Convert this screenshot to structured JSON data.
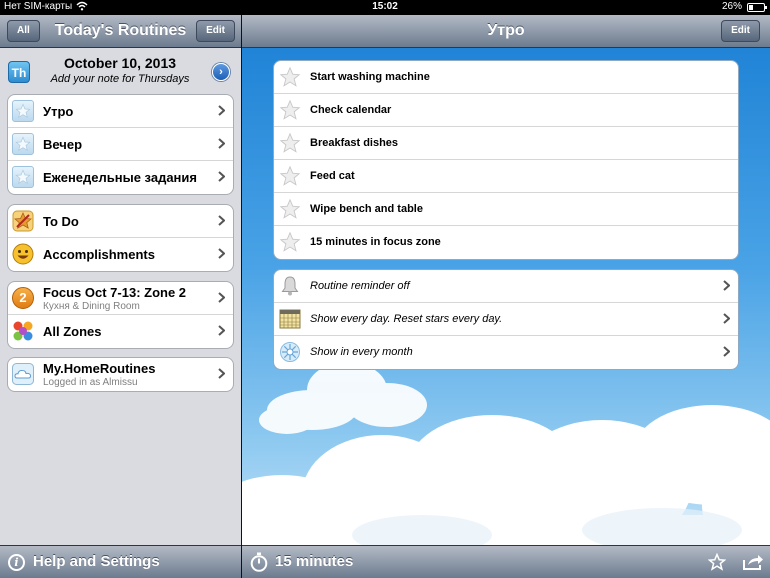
{
  "status": {
    "carrier": "Нет SIM-карты",
    "time": "15:02",
    "battery": "26%"
  },
  "left": {
    "title": "Today's Routines",
    "all_label": "All",
    "edit_label": "Edit",
    "date": "October 10, 2013",
    "note": "Add your note for Thursdays",
    "th_label": "Th",
    "routines": [
      {
        "label": "Утро",
        "icon": "star-icon"
      },
      {
        "label": "Вечер",
        "icon": "star-icon"
      },
      {
        "label": "Еженедельные задания",
        "icon": "star-icon"
      }
    ],
    "lists": [
      {
        "label": "To Do",
        "icon": "todo-star-icon"
      },
      {
        "label": "Accomplishments",
        "icon": "smiley-icon"
      }
    ],
    "zones": [
      {
        "label": "Focus Oct 7-13: Zone 2",
        "sub": "Кухня & Dining Room",
        "icon": "zone-number-icon",
        "icon_text": "2"
      },
      {
        "label": "All Zones",
        "icon": "zones-grid-icon"
      }
    ],
    "account": {
      "label": "My.HomeRoutines",
      "sub": "Logged in as Almissu",
      "icon": "cloud-icon"
    },
    "help_label": "Help and Settings"
  },
  "right": {
    "title": "Утро",
    "edit_label": "Edit",
    "tasks": [
      "Start washing machine",
      "Check calendar",
      "Breakfast dishes",
      "Feed cat",
      "Wipe bench and table",
      "15 minutes in focus zone"
    ],
    "options": [
      {
        "label": "Routine reminder off",
        "icon": "bell-icon"
      },
      {
        "label": "Show every day. Reset stars every day.",
        "icon": "calendar-icon"
      },
      {
        "label": "Show in every month",
        "icon": "month-icon"
      }
    ],
    "timer_label": "15 minutes"
  },
  "colors": {
    "nav_top": "#b3bac5",
    "nav_bottom": "#6c7b8f",
    "sky_top": "#1a7fd4",
    "sky_bottom": "#cfe8f8"
  }
}
